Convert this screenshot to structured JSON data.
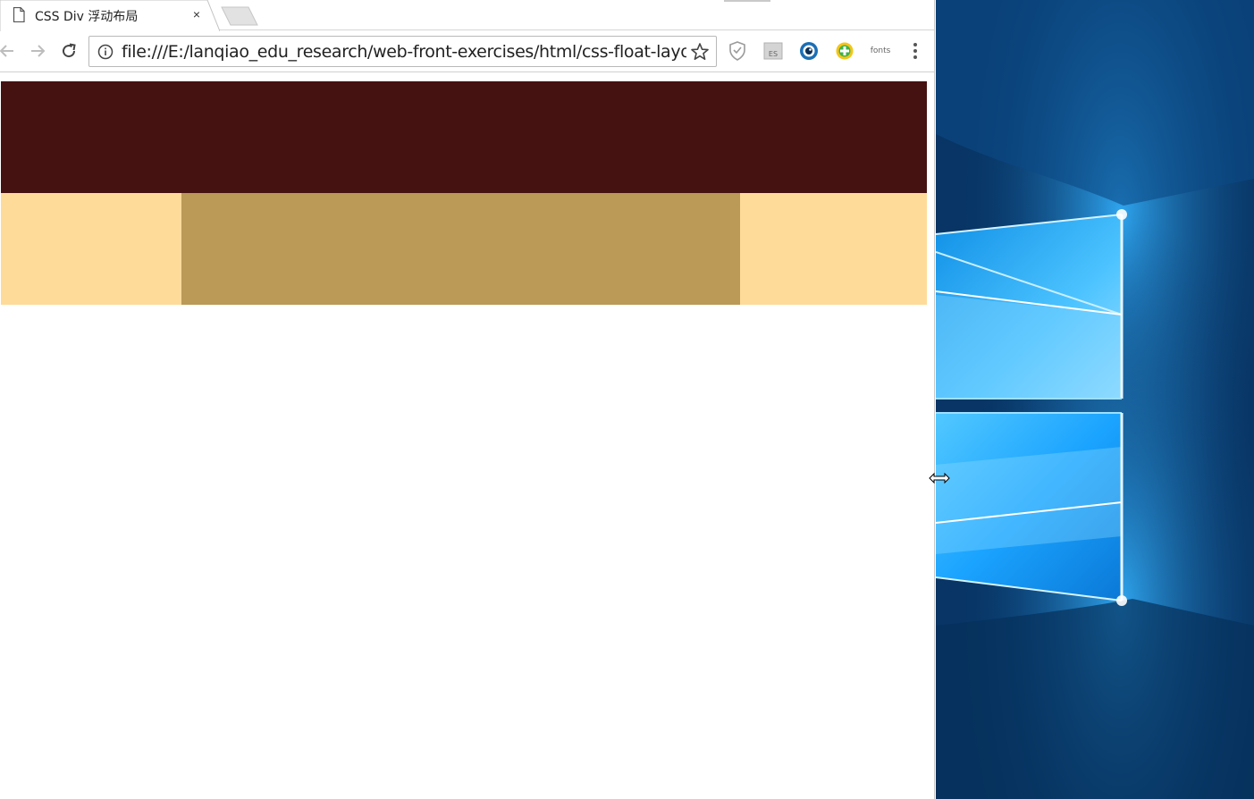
{
  "tab": {
    "title": "CSS Div 浮动布局",
    "close_glyph": "×"
  },
  "toolbar": {
    "url": "file:///E:/lanqiao_edu_research/web-front-exercises/html/css-float-layout.html",
    "extensions": [
      {
        "name": "shield-extension"
      },
      {
        "name": "es-extension",
        "label": "ES"
      },
      {
        "name": "eye-extension"
      },
      {
        "name": "plus-extension"
      },
      {
        "name": "fonts-extension",
        "label": "fonts"
      }
    ]
  },
  "page": {
    "header_color": "#461111",
    "left_color": "#ffdb99",
    "center_color": "#bb9957",
    "right_color": "#ffdb99"
  },
  "desktop": {
    "background": "#0a3d72",
    "accent": "#1aa3ff"
  }
}
